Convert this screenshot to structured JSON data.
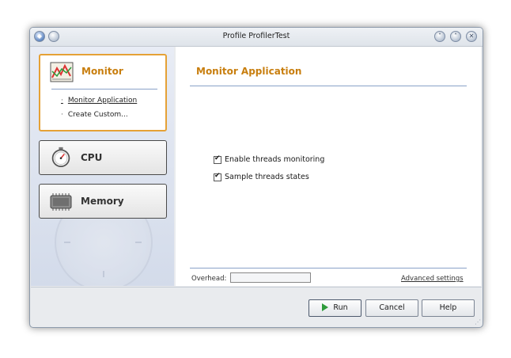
{
  "window": {
    "title": "Profile ProfilerTest"
  },
  "sidebar": {
    "categories": [
      {
        "label": "Monitor",
        "selected": true,
        "icon": "monitor-chart-icon",
        "subitems": [
          {
            "label": "Monitor Application",
            "active": true
          },
          {
            "label": "Create Custom...",
            "active": false
          }
        ]
      },
      {
        "label": "CPU",
        "selected": false,
        "icon": "stopwatch-icon"
      },
      {
        "label": "Memory",
        "selected": false,
        "icon": "memory-chip-icon"
      }
    ]
  },
  "main": {
    "title": "Monitor Application",
    "options": [
      {
        "label": "Enable threads monitoring",
        "checked": true
      },
      {
        "label": "Sample threads states",
        "checked": true
      }
    ],
    "overhead_label": "Overhead:",
    "advanced_link": "Advanced settings"
  },
  "buttons": {
    "run": "Run",
    "cancel": "Cancel",
    "help": "Help"
  },
  "colors": {
    "accent": "#c87e0e",
    "selection_border": "#e5a136",
    "separator": "#8aa2c8"
  }
}
